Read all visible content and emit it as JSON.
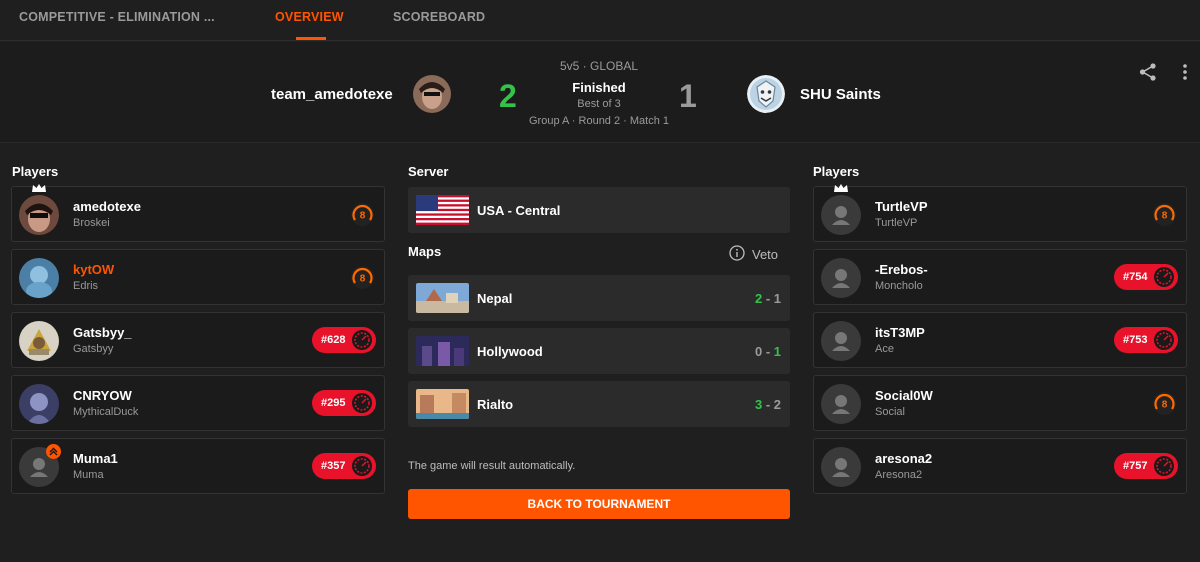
{
  "nav": {
    "tabs": [
      {
        "label": "COMPETITIVE - ELIMINATION ..."
      },
      {
        "label": "OVERVIEW"
      },
      {
        "label": "SCOREBOARD"
      }
    ]
  },
  "match": {
    "mode": "5v5 · GLOBAL",
    "status": "Finished",
    "format": "Best of 3",
    "stage": "Group A · Round 2 · Match 1",
    "team1": {
      "name": "team_amedotexe",
      "score": "2"
    },
    "team2": {
      "name": "SHU Saints",
      "score": "1"
    }
  },
  "left_players": {
    "title": "Players",
    "items": [
      {
        "name": "amedotexe",
        "sub": "Broskei",
        "rank": "8",
        "rank_type": "level",
        "crown": true
      },
      {
        "name": "kytOW",
        "sub": "Edris",
        "rank": "8",
        "rank_type": "level",
        "highlight": true
      },
      {
        "name": "Gatsbyy_",
        "sub": "Gatsbyy",
        "rank": "#628",
        "rank_type": "pill"
      },
      {
        "name": "CNRYOW",
        "sub": "MythicalDuck",
        "rank": "#295",
        "rank_type": "pill"
      },
      {
        "name": "Muma1",
        "sub": "Muma",
        "rank": "#357",
        "rank_type": "pill"
      }
    ]
  },
  "right_players": {
    "title": "Players",
    "items": [
      {
        "name": "TurtleVP",
        "sub": "TurtleVP",
        "rank": "8",
        "rank_type": "level",
        "crown": true
      },
      {
        "name": "-Erebos-",
        "sub": "Moncholo",
        "rank": "#754",
        "rank_type": "pill"
      },
      {
        "name": "itsT3MP",
        "sub": "Ace",
        "rank": "#753",
        "rank_type": "pill"
      },
      {
        "name": "Social0W",
        "sub": "Social",
        "rank": "8",
        "rank_type": "level"
      },
      {
        "name": "aresona2",
        "sub": "Aresona2",
        "rank": "#757",
        "rank_type": "pill"
      }
    ]
  },
  "server": {
    "title": "Server",
    "location": "USA - Central"
  },
  "maps": {
    "title": "Maps",
    "veto_label": "Veto",
    "items": [
      {
        "name": "Nepal",
        "score_a": "2",
        "score_b": "1"
      },
      {
        "name": "Hollywood",
        "score_a": "0",
        "score_b": "1"
      },
      {
        "name": "Rialto",
        "score_a": "3",
        "score_b": "2"
      }
    ]
  },
  "footer": {
    "note": "The game will result automatically.",
    "button": "BACK TO TOURNAMENT"
  },
  "colors": {
    "accent": "#ff5500",
    "win": "#35c24a",
    "rank_pill": "#e8132b"
  }
}
